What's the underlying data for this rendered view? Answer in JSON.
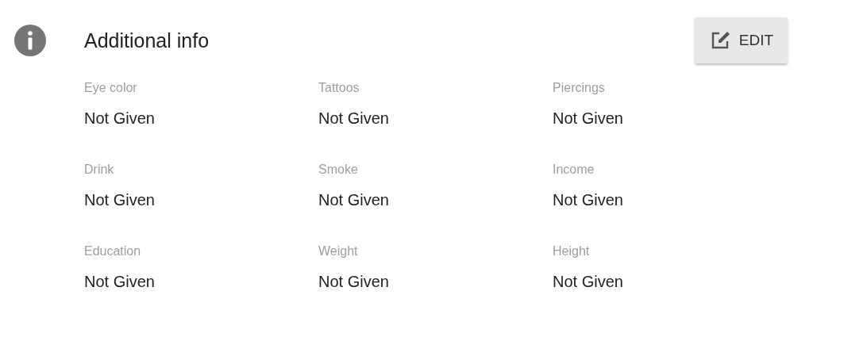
{
  "section": {
    "title": "Additional info"
  },
  "edit_button": {
    "label": "EDIT"
  },
  "fields": [
    {
      "label": "Eye color",
      "value": "Not Given"
    },
    {
      "label": "Tattoos",
      "value": "Not Given"
    },
    {
      "label": "Piercings",
      "value": "Not Given"
    },
    {
      "label": "Drink",
      "value": "Not Given"
    },
    {
      "label": "Smoke",
      "value": "Not Given"
    },
    {
      "label": "Income",
      "value": "Not Given"
    },
    {
      "label": "Education",
      "value": "Not Given"
    },
    {
      "label": "Weight",
      "value": "Not Given"
    },
    {
      "label": "Height",
      "value": "Not Given"
    }
  ]
}
